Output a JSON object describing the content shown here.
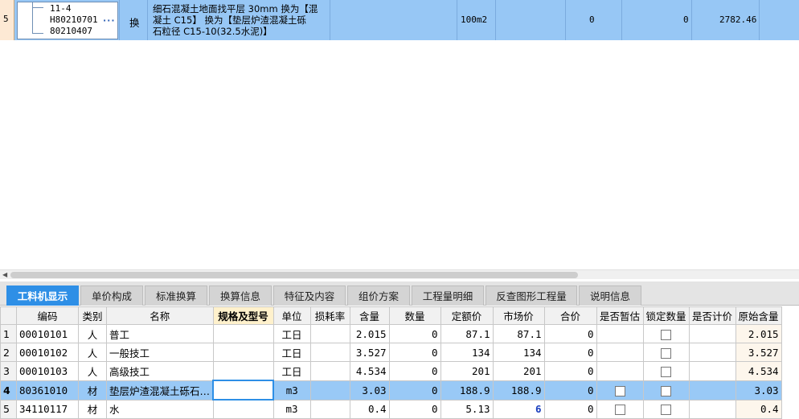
{
  "top_row": {
    "row_num": "5",
    "code_line1": "11-4",
    "code_line2": "H80210701",
    "code_line3": "80210407",
    "more_glyph": "···",
    "type": "换",
    "name_lines": [
      "细石混凝土地面找平层 30mm  换为【混",
      "凝土 C15】  换为【垫层炉渣混凝土砾",
      "石粒径 C15-10(32.5水泥)】"
    ],
    "unit": "100m2",
    "val1": "0",
    "val2": "0",
    "total": "2782.46"
  },
  "tabs": [
    {
      "label": "工料机显示",
      "active": true
    },
    {
      "label": "单价构成"
    },
    {
      "label": "标准换算"
    },
    {
      "label": "换算信息"
    },
    {
      "label": "特征及内容"
    },
    {
      "label": "组价方案"
    },
    {
      "label": "工程量明细"
    },
    {
      "label": "反查图形工程量"
    },
    {
      "label": "说明信息"
    }
  ],
  "grid": {
    "headers": [
      "",
      "编码",
      "类别",
      "名称",
      "规格及型号",
      "单位",
      "损耗率",
      "含量",
      "数量",
      "定额价",
      "市场价",
      "合价",
      "是否暂估",
      "锁定数量",
      "是否计价",
      "原始含量"
    ],
    "rows": [
      {
        "no": "1",
        "code": "00010101",
        "cat": "人",
        "name": "普工",
        "spec": "",
        "unit": "工日",
        "loss": "",
        "content": "2.015",
        "qty": "0",
        "quota": "87.1",
        "market": "87.1",
        "total": "0",
        "temp": false,
        "lock": true,
        "priced": "",
        "orig": "2.015"
      },
      {
        "no": "2",
        "code": "00010102",
        "cat": "人",
        "name": "一般技工",
        "spec": "",
        "unit": "工日",
        "loss": "",
        "content": "3.527",
        "qty": "0",
        "quota": "134",
        "market": "134",
        "total": "0",
        "temp": false,
        "lock": true,
        "priced": "",
        "orig": "3.527"
      },
      {
        "no": "3",
        "code": "00010103",
        "cat": "人",
        "name": "高级技工",
        "spec": "",
        "unit": "工日",
        "loss": "",
        "content": "4.534",
        "qty": "0",
        "quota": "201",
        "market": "201",
        "total": "0",
        "temp": false,
        "lock": true,
        "priced": "",
        "orig": "4.534"
      },
      {
        "no": "4",
        "code": "80361010",
        "cat": "材",
        "name": "垫层炉渣混凝土砾石…",
        "spec": "",
        "unit": "m3",
        "loss": "",
        "content": "3.03",
        "qty": "0",
        "quota": "188.9",
        "market": "188.9",
        "total": "0",
        "temp": true,
        "lock": true,
        "priced": "",
        "orig": "3.03",
        "selected": true
      },
      {
        "no": "5",
        "code": "34110117",
        "cat": "材",
        "name": "水",
        "spec": "",
        "unit": "m3",
        "loss": "",
        "content": "0.4",
        "qty": "0",
        "quota": "5.13",
        "market": "6",
        "total": "0",
        "temp": true,
        "lock": true,
        "priced": "",
        "orig": "0.4",
        "market_highlight": true
      }
    ]
  }
}
